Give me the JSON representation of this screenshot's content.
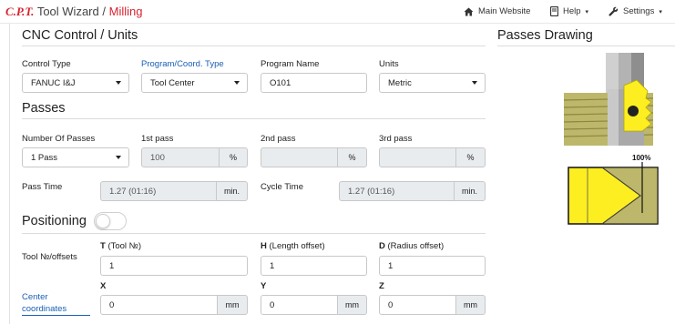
{
  "navbar": {
    "logo": "C.P.T.",
    "app_title": "Tool Wizard",
    "separator": "/",
    "module": "Milling",
    "links": {
      "main_website": "Main Website",
      "help": "Help",
      "settings": "Settings"
    }
  },
  "cnc": {
    "title": "CNC Control / Units",
    "control_type": {
      "label": "Control Type",
      "value": "FANUC I&J"
    },
    "program_type": {
      "label": "Program/Coord. Type",
      "value": "Tool Center"
    },
    "program_name": {
      "label": "Program Name",
      "value": "O101"
    },
    "units": {
      "label": "Units",
      "value": "Metric"
    }
  },
  "passes": {
    "title": "Passes",
    "number": {
      "label": "Number Of Passes",
      "value": "1 Pass"
    },
    "first": {
      "label": "1st pass",
      "value": "100",
      "unit": "%"
    },
    "second": {
      "label": "2nd pass",
      "value": "",
      "unit": "%"
    },
    "third": {
      "label": "3rd pass",
      "value": "",
      "unit": "%"
    },
    "pass_time": {
      "label": "Pass Time",
      "value": "1.27 (01:16)",
      "unit": "min."
    },
    "cycle_time": {
      "label": "Cycle Time",
      "value": "1.27 (01:16)",
      "unit": "min."
    }
  },
  "positioning": {
    "title": "Positioning",
    "toggle_on": false,
    "tool_offsets_label": "Tool №/offsets",
    "t": {
      "key": "T",
      "label": " (Tool №)",
      "value": "1"
    },
    "h": {
      "key": "H",
      "label": " (Length offset)",
      "value": "1"
    },
    "d": {
      "key": "D",
      "label": " (Radius offset)",
      "value": "1"
    },
    "center_coordinates_label_1": "Center",
    "center_coordinates_label_2": "coordinates",
    "x": {
      "key": "X",
      "value": "0",
      "unit": "mm"
    },
    "y": {
      "key": "Y",
      "value": "0",
      "unit": "mm"
    },
    "z": {
      "key": "Z",
      "value": "0",
      "unit": "mm"
    }
  },
  "drawing": {
    "title": "Passes Drawing",
    "percent": "100%",
    "colors": {
      "yellow": "#fcee21",
      "olive": "#c7c06a",
      "gray": "#a8a8a8"
    }
  },
  "colors": {
    "brand_red": "#d9232e",
    "link_blue": "#1a5fb4"
  }
}
